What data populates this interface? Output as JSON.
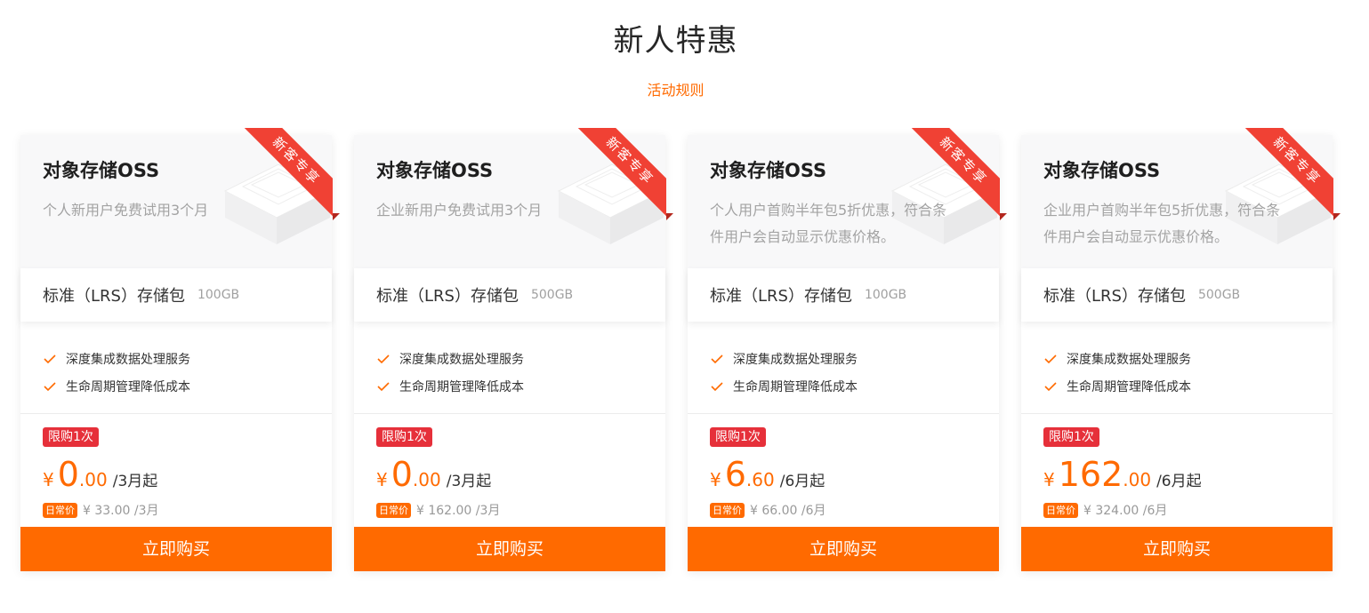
{
  "page": {
    "title": "新人特惠",
    "rules_link": "活动规则"
  },
  "colors": {
    "accent": "#ff6a00",
    "badge_red": "#e6303a",
    "ribbon_red": "#f04134"
  },
  "icons": {
    "feature_check": "check-icon",
    "head_decoration": "storage-box-illustration"
  },
  "cards": [
    {
      "title": "对象存储OSS",
      "ribbon": "新客专享",
      "desc": "个人新用户免费试用3个月",
      "spec_name": "标准（LRS）存储包",
      "spec_size": "100GB",
      "features": [
        "深度集成数据处理服务",
        "生命周期管理降低成本"
      ],
      "limit": "限购1次",
      "currency": "¥",
      "price_int": "0",
      "price_dec": ".00",
      "period": "/3月起",
      "regular_tag": "日常价",
      "regular_price": "¥ 33.00 /3月",
      "buy": "立即购买"
    },
    {
      "title": "对象存储OSS",
      "ribbon": "新客专享",
      "desc": "企业新用户免费试用3个月",
      "spec_name": "标准（LRS）存储包",
      "spec_size": "500GB",
      "features": [
        "深度集成数据处理服务",
        "生命周期管理降低成本"
      ],
      "limit": "限购1次",
      "currency": "¥",
      "price_int": "0",
      "price_dec": ".00",
      "period": "/3月起",
      "regular_tag": "日常价",
      "regular_price": "¥ 162.00 /3月",
      "buy": "立即购买"
    },
    {
      "title": "对象存储OSS",
      "ribbon": "新客专享",
      "desc": "个人用户首购半年包5折优惠，符合条件用户会自动显示优惠价格。",
      "spec_name": "标准（LRS）存储包",
      "spec_size": "100GB",
      "features": [
        "深度集成数据处理服务",
        "生命周期管理降低成本"
      ],
      "limit": "限购1次",
      "currency": "¥",
      "price_int": "6",
      "price_dec": ".60",
      "period": "/6月起",
      "regular_tag": "日常价",
      "regular_price": "¥ 66.00 /6月",
      "buy": "立即购买"
    },
    {
      "title": "对象存储OSS",
      "ribbon": "新客专享",
      "desc": "企业用户首购半年包5折优惠，符合条件用户会自动显示优惠价格。",
      "spec_name": "标准（LRS）存储包",
      "spec_size": "500GB",
      "features": [
        "深度集成数据处理服务",
        "生命周期管理降低成本"
      ],
      "limit": "限购1次",
      "currency": "¥",
      "price_int": "162",
      "price_dec": ".00",
      "period": "/6月起",
      "regular_tag": "日常价",
      "regular_price": "¥ 324.00 /6月",
      "buy": "立即购买"
    }
  ]
}
